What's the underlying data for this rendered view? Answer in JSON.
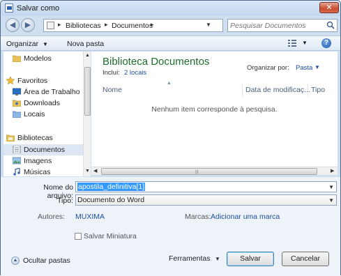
{
  "window": {
    "title": "Salvar como",
    "close_label": "✕"
  },
  "address": {
    "breadcrumbs": [
      "Bibliotecas",
      "Documentos"
    ],
    "search_placeholder": "Pesquisar Documentos"
  },
  "toolbar": {
    "organize_label": "Organizar",
    "new_folder_label": "Nova pasta"
  },
  "nav_pane": {
    "items": [
      {
        "label": "Modelos",
        "icon": "folder-icon"
      },
      {
        "label": "Favoritos",
        "icon": "star-icon"
      },
      {
        "label": "Área de Trabalho",
        "icon": "desktop-icon"
      },
      {
        "label": "Downloads",
        "icon": "downloads-icon"
      },
      {
        "label": "Locais",
        "icon": "recent-places-icon"
      },
      {
        "label": "Bibliotecas",
        "icon": "libraries-icon"
      },
      {
        "label": "Documentos",
        "icon": "documents-icon",
        "selected": true
      },
      {
        "label": "Imagens",
        "icon": "pictures-icon"
      },
      {
        "label": "Músicas",
        "icon": "music-icon"
      }
    ]
  },
  "library": {
    "title": "Biblioteca Documentos",
    "includes_label": "Inclui:",
    "includes_link": "2 locais",
    "arrange_label": "Organizar por:",
    "arrange_value": "Pasta",
    "columns": [
      "Nome",
      "Data de modificaç...",
      "Tipo"
    ],
    "empty_message": "Nenhum item corresponde à pesquisa."
  },
  "form": {
    "filename_label": "Nome do arquivo:",
    "filename_value": "apostila_definitiva[1]",
    "type_label": "Tipo:",
    "type_value": "Documento do Word",
    "authors_label": "Autores:",
    "authors_value": "MUXIMA",
    "tags_label": "Marcas:",
    "tags_value": "Adicionar uma marca",
    "thumbnail_label": "Salvar Miniatura",
    "thumbnail_checked": false
  },
  "footer": {
    "hide_folders_label": "Ocultar pastas",
    "tools_label": "Ferramentas",
    "save_label": "Salvar",
    "cancel_label": "Cancelar"
  },
  "colors": {
    "library_title": "#1e6d2c",
    "link": "#1c4fa0",
    "selection": "#3399ff"
  }
}
